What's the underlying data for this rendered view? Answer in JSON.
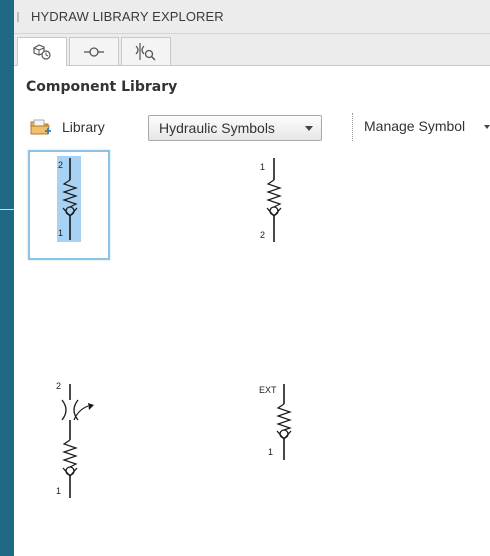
{
  "window": {
    "title": "HYDRAW LIBRARY EXPLORER"
  },
  "tabs": [
    {
      "icon": "library-tab-icon",
      "active": true
    },
    {
      "icon": "connector-tab-icon",
      "active": false
    },
    {
      "icon": "search-symbol-tab-icon",
      "active": false
    }
  ],
  "section": {
    "title": "Component Library"
  },
  "toolbar": {
    "library_label": "Library",
    "library_icon": "folder-library-icon",
    "dropdown_value": "Hydraulic Symbols",
    "manage_label": "Manage Symbol"
  },
  "symbols": [
    {
      "name": "check-valve-spring",
      "port_top": "2",
      "port_bottom": "1",
      "selected": true
    },
    {
      "name": "check-valve-spring-reversed",
      "port_top": "1",
      "port_bottom": "2",
      "selected": false
    },
    {
      "name": "flow-control-check-valve",
      "port_top": "2",
      "port_bottom": "1",
      "selected": false
    },
    {
      "name": "check-valve-external",
      "port_top": "EXT",
      "port_bottom": "1",
      "selected": false
    }
  ],
  "colors": {
    "background": "#1e6a86",
    "selection_fill": "#a8d2f3",
    "selection_border": "#8ec3e6"
  }
}
